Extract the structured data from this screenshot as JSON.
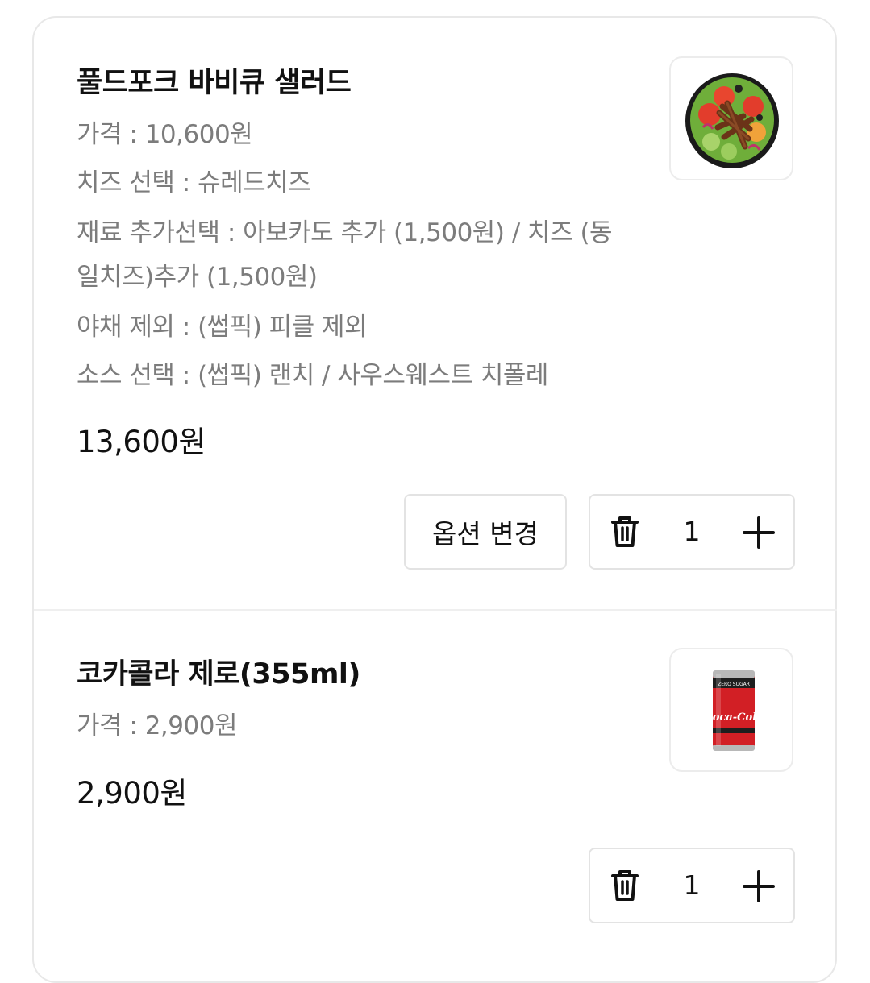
{
  "items": [
    {
      "name": "풀드포크 바비큐 샐러드",
      "options": [
        "가격 : 10,600원",
        "치즈 선택 : 슈레드치즈",
        "재료 추가선택 : 아보카도 추가 (1,500원) / 치즈 (동일치즈)추가 (1,500원)",
        "야채 제외 : (썹픽) 피클 제외",
        "소스 선택 : (썹픽) 랜치 / 사우스웨스트 치폴레"
      ],
      "total": "13,600원",
      "option_button_label": "옵션 변경",
      "quantity": "1"
    },
    {
      "name": "코카콜라 제로(355ml)",
      "options": [
        "가격 : 2,900원"
      ],
      "total": "2,900원",
      "quantity": "1",
      "can_brand_text": "Coca-Cola",
      "can_top_text": "ZERO SUGAR"
    }
  ],
  "icons": {
    "delete": "trash-icon",
    "increase": "plus-icon"
  },
  "colors": {
    "text_primary": "#111111",
    "text_secondary": "#7c7c7c",
    "border": "#e3e3e3",
    "coke_red": "#d21f25"
  }
}
